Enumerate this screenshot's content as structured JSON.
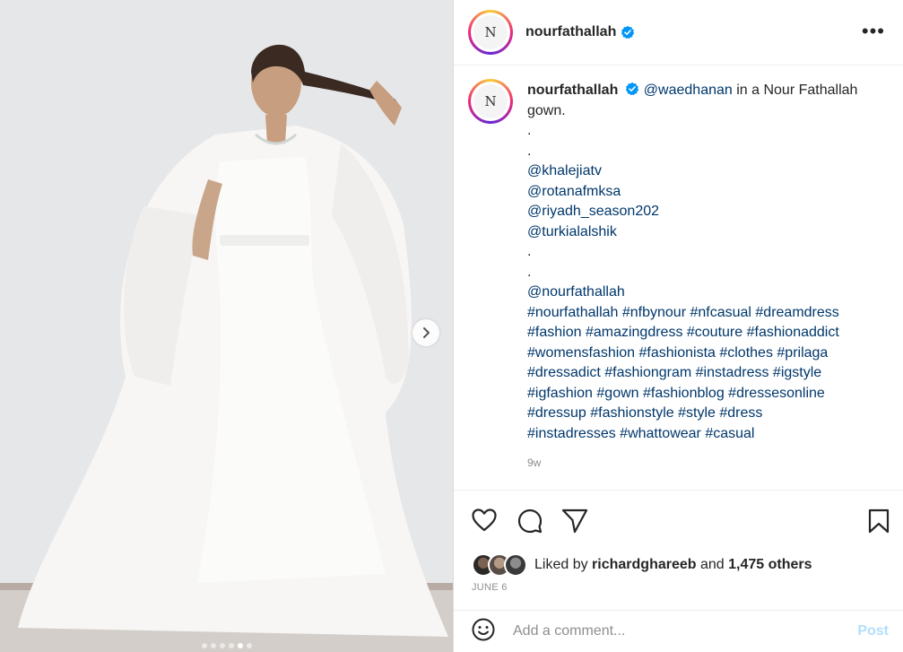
{
  "post": {
    "username": "nourfathallah",
    "avatar_monogram": "N",
    "more_label": "•••",
    "caption": {
      "username": "nourfathallah",
      "mention": "@waedhanan",
      "text": " in a Nour Fathallah gown.",
      "lines": [
        {
          "text": ".",
          "link": false
        },
        {
          "text": ".",
          "link": false
        },
        {
          "text": "@khalejiatv",
          "link": true
        },
        {
          "text": "@rotanafmksa",
          "link": true
        },
        {
          "text": "@riyadh_season202",
          "link": true
        },
        {
          "text": "@turkialalshik",
          "link": true
        },
        {
          "text": ".",
          "link": false
        },
        {
          "text": ".",
          "link": false
        },
        {
          "text": "@nourfathallah",
          "link": true
        },
        {
          "text": "#nourfathallah #nfbynour #nfcasual #dreamdress",
          "link": true
        },
        {
          "text": "#fashion #amazingdress #couture #fashionaddict",
          "link": true
        },
        {
          "text": "#womensfashion #fashionista #clothes #prilaga",
          "link": true
        },
        {
          "text": "#dressadict #fashiongram #instadress #igstyle",
          "link": true
        },
        {
          "text": "#igfashion #gown #fashionblog #dressesonline",
          "link": true
        },
        {
          "text": "#dressup #fashionstyle #style #dress",
          "link": true
        },
        {
          "text": "#instadresses #whattowear #casual",
          "link": true
        }
      ],
      "time": "9w"
    },
    "likes": {
      "prefix": "Liked by ",
      "user": "richardghareeb",
      "middle": " and ",
      "count": "1,475 others"
    },
    "date": "JUNE 6",
    "comment": {
      "placeholder": "Add a comment...",
      "post_label": "Post"
    },
    "carousel": {
      "total": 6,
      "active_index": 4
    }
  },
  "colors": {
    "link": "#00376b",
    "verified": "#0095f6",
    "muted": "#8e8e8e",
    "post_disabled": "#b2dffc"
  }
}
